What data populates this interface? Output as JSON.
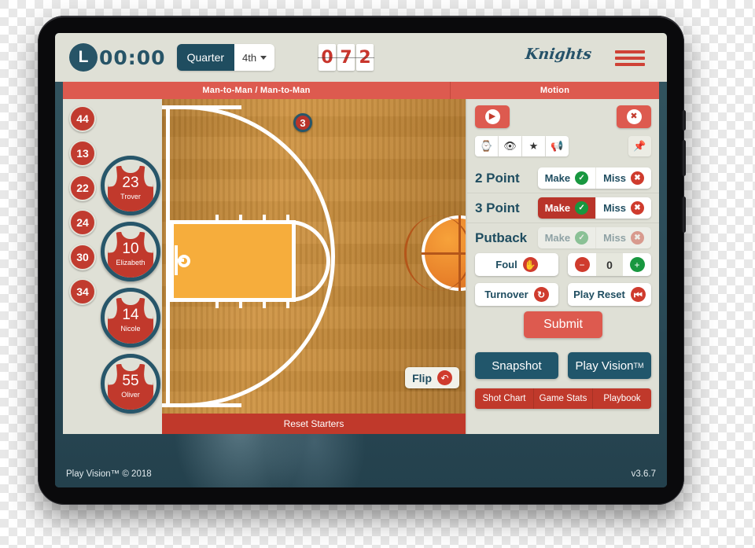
{
  "header": {
    "clock_icon": "clock-icon",
    "clock_letter": "L",
    "game_clock": "00:00",
    "quarter_label": "Quarter",
    "quarter_value": "4th",
    "score_digits": [
      "0",
      "7",
      "2"
    ],
    "team_name": "Knights",
    "menu_icon": "hamburger-menu-icon"
  },
  "tagbar": {
    "defense": "Man-to-Man / Man-to-Man",
    "offense": "Motion"
  },
  "roster": {
    "bench_numbers": [
      "44",
      "13",
      "22",
      "24",
      "30",
      "34"
    ],
    "active_players": [
      {
        "number": "23",
        "name": "Trover"
      },
      {
        "number": "10",
        "name": "Elizabeth"
      },
      {
        "number": "14",
        "name": "Nicole"
      },
      {
        "number": "55",
        "name": "Oliver"
      }
    ]
  },
  "court": {
    "markers": [
      {
        "label": "3"
      }
    ],
    "flip_label": "Flip",
    "flip_icon": "undo-arrow-icon",
    "reset_starters": "Reset Starters",
    "ball_icon": "basketball-icon"
  },
  "panel": {
    "play_button_icon": "play-icon",
    "close_button_icon": "close-x-icon",
    "tool_icons": [
      {
        "name": "hourglass-icon",
        "glyph": "⧖"
      },
      {
        "name": "eye-icon",
        "glyph": "◉"
      },
      {
        "name": "star-icon",
        "glyph": "★"
      },
      {
        "name": "megaphone-icon",
        "glyph": "◤"
      }
    ],
    "pin_icon": {
      "name": "pushpin-icon",
      "glyph": "✒"
    },
    "shot_rows": [
      {
        "label": "2 Point",
        "make": "Make",
        "miss": "Miss",
        "make_selected": false,
        "disabled": false
      },
      {
        "label": "3 Point",
        "make": "Make",
        "miss": "Miss",
        "make_selected": true,
        "disabled": false
      },
      {
        "label": "Putback",
        "make": "Make",
        "miss": "Miss",
        "make_selected": false,
        "disabled": true
      }
    ],
    "foul_label": "Foul",
    "foul_icon": "hand-stop-icon",
    "counter_value": "0",
    "minus_label": "−",
    "plus_label": "+",
    "turnover_label": "Turnover",
    "turnover_icon": "refresh-icon",
    "play_reset_label": "Play Reset",
    "play_reset_icon": "rewind-icon",
    "submit_label": "Submit",
    "snapshot_label": "Snapshot",
    "play_vision_label": "Play Vision",
    "play_vision_sup": "TM",
    "nav_buttons": [
      "Shot Chart",
      "Game Stats",
      "Playbook"
    ]
  },
  "footer": {
    "copyright": "Play Vision™ © 2018",
    "version": "v3.6.7"
  },
  "colors": {
    "accent_red": "#dd5a4f",
    "deep_red": "#c0392b",
    "teal": "#21566b",
    "panel_bg": "#dfe0d6",
    "court_wood": "#c2893a",
    "key_orange": "#f6ad3c",
    "green": "#18973f"
  }
}
